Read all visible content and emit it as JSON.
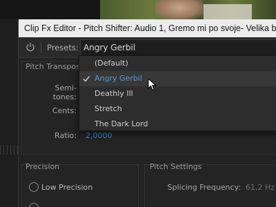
{
  "window": {
    "title": "Clip Fx Editor - Pitch Shifter: Audio 1, Gremo mi po svoje- Velika bela ne"
  },
  "toolbar": {
    "presets_label": "Presets:",
    "selected_preset": "Angry Gerbil"
  },
  "pitch_transpose": {
    "heading": "Pitch Transpose",
    "semitones_label": "Semi-tones:",
    "cents_label": "Cents:",
    "ratio_label": "Ratio:",
    "ratio_value": "2,0000"
  },
  "precision": {
    "heading": "Precision",
    "options": [
      "Low Precision"
    ]
  },
  "pitch_settings": {
    "heading": "Pitch Settings",
    "splicing_label": "Splicing Frequency:",
    "splicing_value": "61,2 Hz"
  },
  "dropdown": {
    "items": [
      "(Default)",
      "Angry Gerbil",
      "Deathly Ill",
      "Stretch",
      "The Dark Lord"
    ],
    "selected_index": 1
  },
  "colors": {
    "accent": "#3a8fd9",
    "selected_text": "#4a9de0",
    "titlebar_bg": "#ececec",
    "panel_bg": "#232323"
  },
  "icons": {
    "power": "power-icon",
    "check": "checkmark-icon",
    "cursor": "mouse-pointer-icon"
  }
}
